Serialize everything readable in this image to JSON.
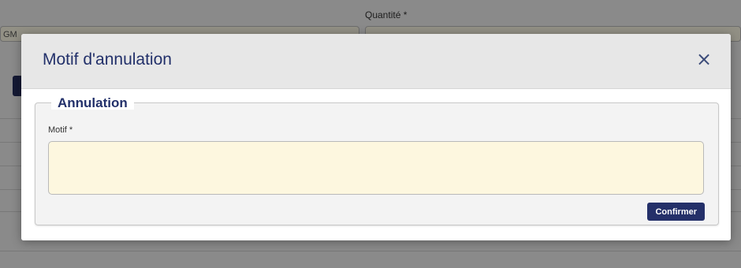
{
  "background": {
    "quantity_label": "Quantité *",
    "code_fragment": "GM"
  },
  "modal": {
    "title": "Motif d'annulation",
    "close_symbol": "×",
    "fieldset_legend": "Annulation",
    "motif_label": "Motif *",
    "motif_value": "",
    "confirm_label": "Confirmer"
  },
  "colors": {
    "brand_navy": "#22306a",
    "textarea_background": "#fdf7df"
  },
  "icons": {
    "close": "close-icon"
  }
}
